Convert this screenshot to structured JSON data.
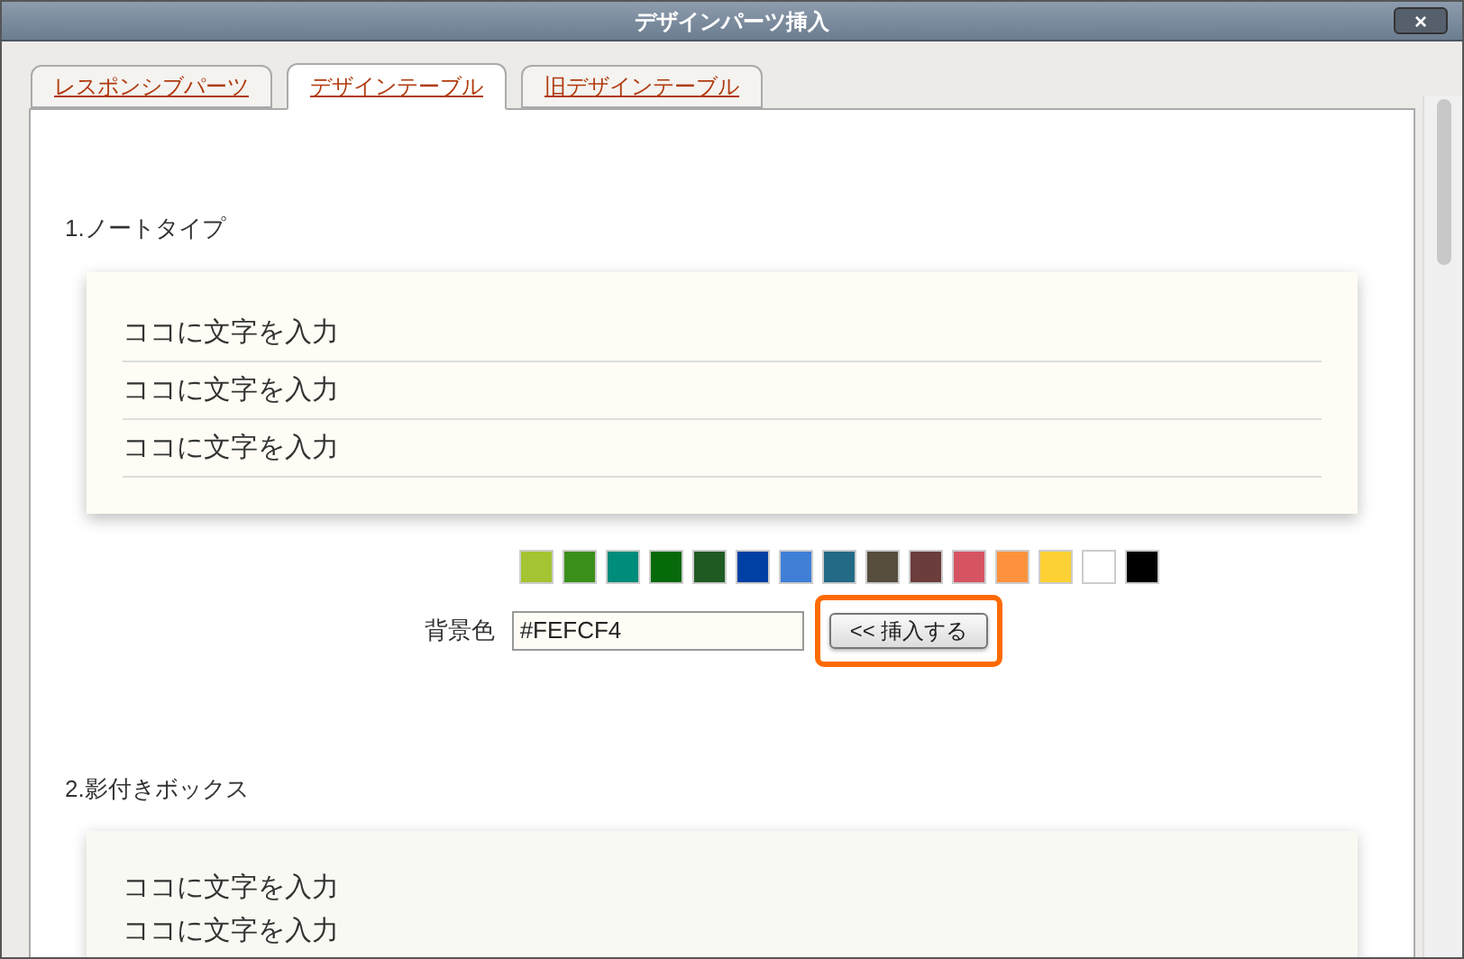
{
  "window": {
    "title": "デザインパーツ挿入",
    "close_label": "×"
  },
  "tabs": [
    {
      "label": "レスポンシブパーツ",
      "selected": false
    },
    {
      "label": "デザインテーブル",
      "selected": true
    },
    {
      "label": "旧デザインテーブル",
      "selected": false
    }
  ],
  "sections": [
    {
      "kind": "note",
      "heading": "1.ノートタイプ",
      "lines": [
        "ココに文字を入力",
        "ココに文字を入力",
        "ココに文字を入力"
      ],
      "swatches": [
        {
          "color": "#a5c431"
        },
        {
          "color": "#3a8f1a"
        },
        {
          "color": "#008c7a"
        },
        {
          "color": "#076a0a"
        },
        {
          "color": "#1f5a23"
        },
        {
          "color": "#003fa3"
        },
        {
          "color": "#3f80d6"
        },
        {
          "color": "#226a85"
        },
        {
          "color": "#574d3d"
        },
        {
          "color": "#6b3d3c"
        },
        {
          "color": "#d65462"
        },
        {
          "color": "#fd923c"
        },
        {
          "color": "#fdd033"
        },
        {
          "color": "#ffffff"
        },
        {
          "color": "#000000"
        }
      ],
      "color_label": "背景色",
      "color_value": "#FEFCF4",
      "insert_button": {
        "label": "<< 挿入する",
        "highlighted": true
      }
    },
    {
      "kind": "shadow",
      "heading": "2.影付きボックス",
      "lines": [
        "ココに文字を入力",
        "ココに文字を入力"
      ]
    }
  ]
}
